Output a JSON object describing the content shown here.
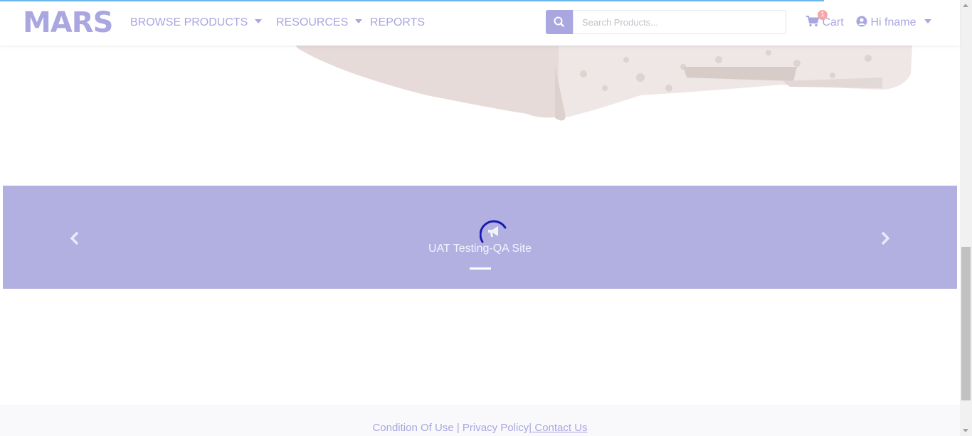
{
  "brand": {
    "logo_text": "MARS"
  },
  "nav": {
    "browse_label": "BROWSE PRODUCTS",
    "resources_label": "RESOURCES",
    "reports_label": "REPORTS"
  },
  "search": {
    "placeholder": "Search Products..."
  },
  "cart": {
    "label": "Cart",
    "count": "1"
  },
  "user": {
    "greeting": "Hi fname"
  },
  "banner": {
    "title": "UAT Testing-QA Site"
  },
  "footer": {
    "conditions": "Condition Of Use",
    "separator": "|",
    "privacy": "Privacy Policy",
    "contact_separator": "|",
    "contact": " Contact Us"
  },
  "colors": {
    "accent": "#a9a6e0",
    "banner_bg": "#b1b0e1",
    "badge": "#f6a6a6",
    "spinner": "#1a1ab0"
  },
  "icons": [
    "search-icon",
    "cart-icon",
    "user-circle-icon",
    "chevron-left-icon",
    "chevron-right-icon",
    "megaphone-icon"
  ]
}
